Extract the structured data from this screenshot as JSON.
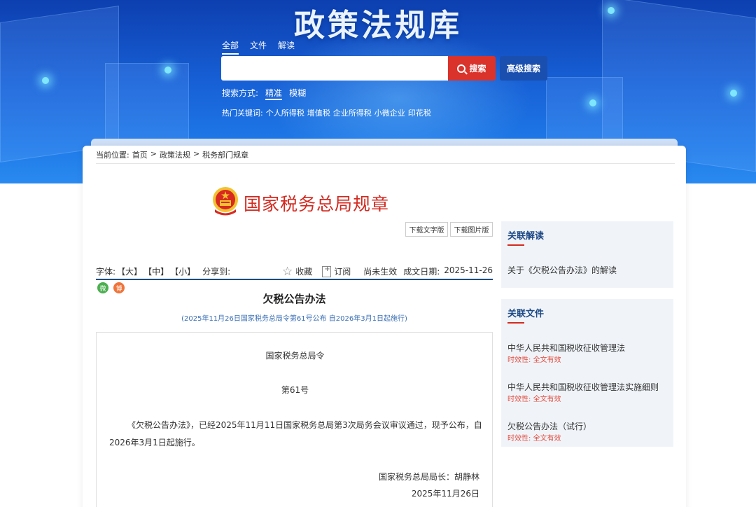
{
  "banner": {
    "title": "政策法规库",
    "tabs": [
      "全部",
      "文件",
      "解读"
    ],
    "search_placeholder": "",
    "search_button": "搜索",
    "advanced_button": "高级搜索",
    "search_mode_label": "搜索方式:",
    "search_modes": [
      "精准",
      "模糊"
    ],
    "hot_label": "热门关键词:",
    "hot_keywords": [
      "个人所得税",
      "增值税",
      "企业所得税",
      "小微企业",
      "印花税"
    ]
  },
  "breadcrumb": {
    "label": "当前位置:",
    "items": [
      "首页",
      "政策法规",
      "税务部门规章"
    ],
    "separator": ">"
  },
  "header": {
    "agency": "国家税务总局规章",
    "download_text": "下载文字版",
    "download_image": "下载图片版"
  },
  "toolbar": {
    "font_label": "字体:",
    "font_sizes": [
      "【大】",
      "【中】",
      "【小】"
    ],
    "share_label": "分享到:",
    "collect": "收藏",
    "subscribe": "订阅",
    "status": "尚未生效",
    "date_label": "成文日期:",
    "date": "2025-11-26"
  },
  "share": {
    "wechat": "微",
    "weibo": "博"
  },
  "document": {
    "title": "欠税公告办法",
    "subtitle": "(2025年11月26日国家税务总局令第61号公布 自2026年3月1日起施行)",
    "issuer": "国家税务总局令",
    "number": "第61号",
    "body_line1": "《欠税公告办法》，已经2025年11月11日国家税务总局第3次局务会议审议通过，现予公布，自",
    "body_line2": "2026年3月1日起施行。",
    "signer": "国家税务总局局长：胡静林",
    "sign_date": "2025年11月26日"
  },
  "sidebar": {
    "related_interpretation": {
      "heading": "关联解读",
      "items": [
        "关于《欠税公告办法》的解读"
      ]
    },
    "related_documents": {
      "heading": "关联文件",
      "items": [
        {
          "title": "中华人民共和国税收征收管理法",
          "status_label": "时效性:",
          "status": "全文有效"
        },
        {
          "title": "中华人民共和国税收征收管理法实施细则",
          "status_label": "时效性:",
          "status": "全文有效"
        },
        {
          "title": "欠税公告办法（试行）",
          "status_label": "时效性:",
          "status": "全文有效"
        }
      ]
    }
  },
  "colors": {
    "banner_blue": "#1760d6",
    "accent_red": "#d32a20",
    "heading_blue": "#1f4a86",
    "link_blue": "#3a6fb5"
  }
}
